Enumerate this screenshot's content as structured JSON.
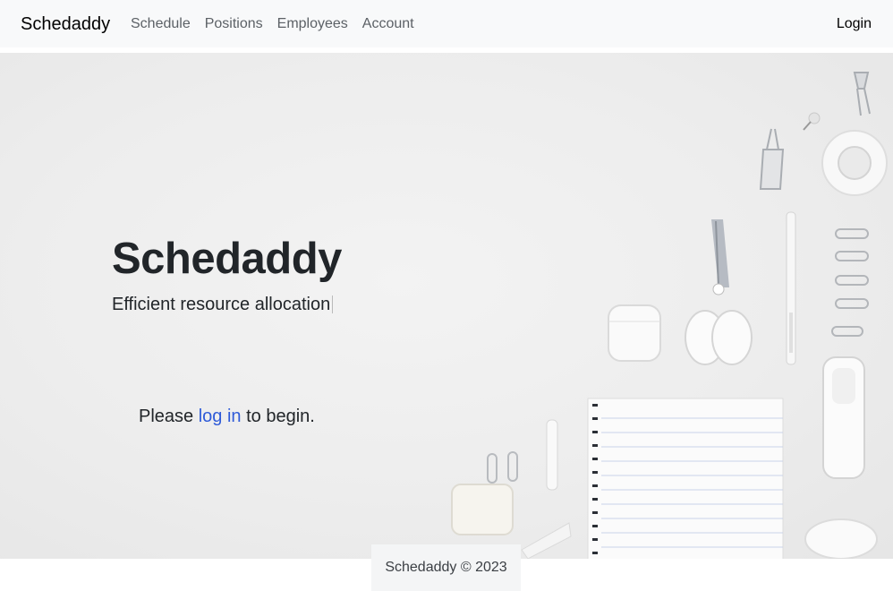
{
  "app": {
    "brand": "Schedaddy"
  },
  "nav": {
    "items": [
      {
        "label": "Schedule"
      },
      {
        "label": "Positions"
      },
      {
        "label": "Employees"
      },
      {
        "label": "Account"
      }
    ],
    "login_label": "Login"
  },
  "hero": {
    "title": "Schedaddy",
    "subtitle": "Efficient resource allocation",
    "prompt_before": "Please ",
    "prompt_link": "log in",
    "prompt_after": " to begin."
  },
  "footer": {
    "text": "Schedaddy © 2023"
  },
  "colors": {
    "navbar_bg": "#f8f9fa",
    "link_accent": "#2f5bd8",
    "text": "#212529"
  }
}
